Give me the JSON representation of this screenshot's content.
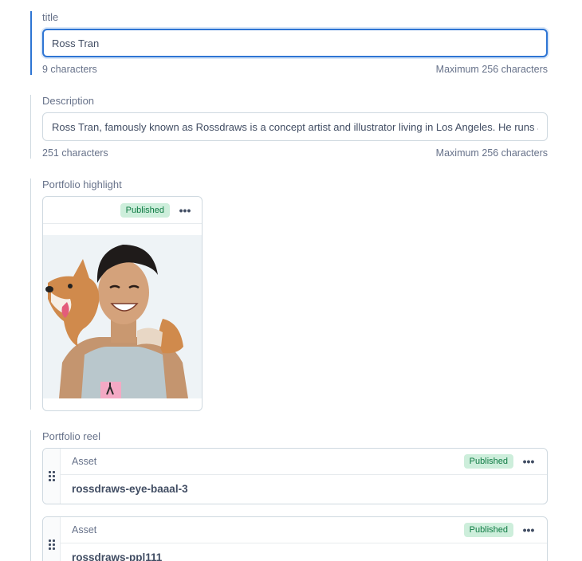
{
  "title_field": {
    "label": "title",
    "value": "Ross Tran",
    "count": "9 characters",
    "max": "Maximum 256 characters"
  },
  "description_field": {
    "label": "Description",
    "value": "Ross Tran, famously known as Rossdraws is a concept artist and illustrator living in Los Angeles. He runs a yout",
    "count": "251 characters",
    "max": "Maximum 256 characters"
  },
  "portfolio_highlight": {
    "label": "Portfolio highlight",
    "status": "Published",
    "more_label": "•••",
    "image_icon": "photo-person-with-dog"
  },
  "portfolio_reel": {
    "label": "Portfolio reel",
    "items": [
      {
        "type": "Asset",
        "status": "Published",
        "name": "rossdraws-eye-baaal-3",
        "more_label": "•••"
      },
      {
        "type": "Asset",
        "status": "Published",
        "name": "rossdraws-ppl111",
        "more_label": "•••"
      }
    ]
  },
  "colors": {
    "accent": "#2e75d4",
    "published_bg": "#cdeedb",
    "published_text": "#0d7a42",
    "border": "#cfd9e0",
    "text": "#414d63",
    "muted": "#67728a"
  }
}
